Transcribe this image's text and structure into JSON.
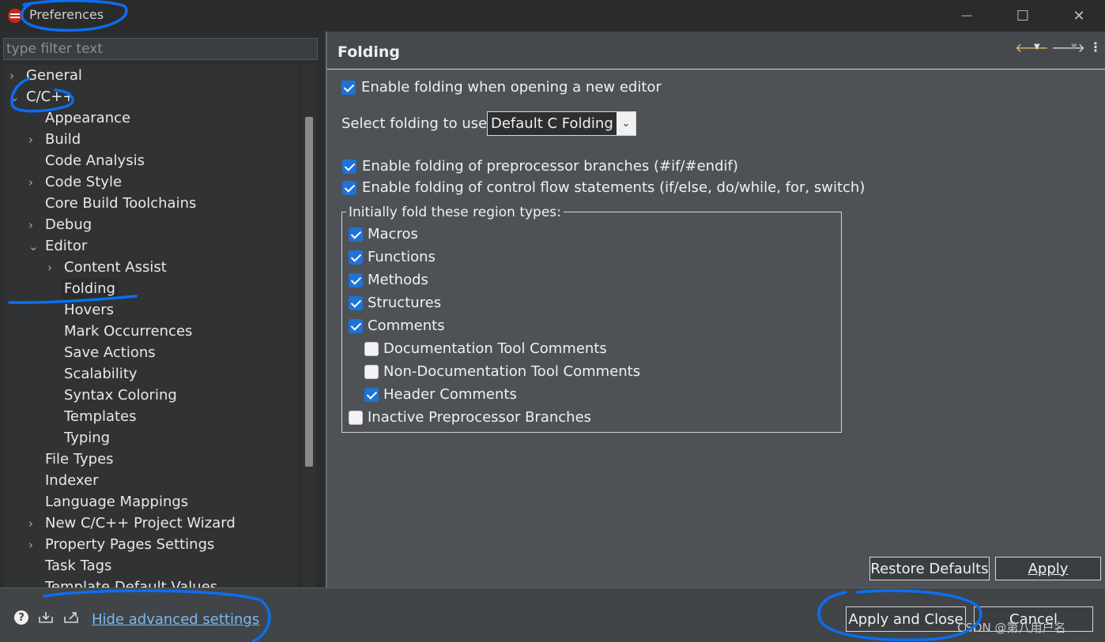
{
  "window": {
    "title": "Preferences",
    "controls": {
      "minimize": "—",
      "maximize": "☐",
      "close": "✕"
    }
  },
  "sidebar": {
    "filter_placeholder": "type filter text",
    "items": [
      {
        "label": "General",
        "level": 0,
        "chevron": "›"
      },
      {
        "label": "C/C++",
        "level": 0,
        "chevron": "⌄"
      },
      {
        "label": "Appearance",
        "level": 1,
        "chevron": ""
      },
      {
        "label": "Build",
        "level": 1,
        "chevron": "›"
      },
      {
        "label": "Code Analysis",
        "level": 1,
        "chevron": ""
      },
      {
        "label": "Code Style",
        "level": 1,
        "chevron": "›"
      },
      {
        "label": "Core Build Toolchains",
        "level": 1,
        "chevron": ""
      },
      {
        "label": "Debug",
        "level": 1,
        "chevron": "›"
      },
      {
        "label": "Editor",
        "level": 1,
        "chevron": "⌄"
      },
      {
        "label": "Content Assist",
        "level": 2,
        "chevron": "›"
      },
      {
        "label": "Folding",
        "level": 2,
        "chevron": "",
        "selected": true
      },
      {
        "label": "Hovers",
        "level": 2,
        "chevron": ""
      },
      {
        "label": "Mark Occurrences",
        "level": 2,
        "chevron": ""
      },
      {
        "label": "Save Actions",
        "level": 2,
        "chevron": ""
      },
      {
        "label": "Scalability",
        "level": 2,
        "chevron": ""
      },
      {
        "label": "Syntax Coloring",
        "level": 2,
        "chevron": ""
      },
      {
        "label": "Templates",
        "level": 2,
        "chevron": ""
      },
      {
        "label": "Typing",
        "level": 2,
        "chevron": ""
      },
      {
        "label": "File Types",
        "level": 1,
        "chevron": ""
      },
      {
        "label": "Indexer",
        "level": 1,
        "chevron": ""
      },
      {
        "label": "Language Mappings",
        "level": 1,
        "chevron": ""
      },
      {
        "label": "New C/C++ Project Wizard",
        "level": 1,
        "chevron": "›"
      },
      {
        "label": "Property Pages Settings",
        "level": 1,
        "chevron": "›"
      },
      {
        "label": "Task Tags",
        "level": 1,
        "chevron": ""
      },
      {
        "label": "Template Default Values",
        "level": 1,
        "chevron": ""
      }
    ]
  },
  "page": {
    "title": "Folding",
    "enable_on_open": {
      "label": "Enable folding when opening a new editor",
      "checked": true
    },
    "select_label": "Select folding to use:",
    "select_value": "Default C Folding",
    "preprocessor": {
      "label": "Enable folding of preprocessor branches (#if/#endif)",
      "checked": true
    },
    "control_flow": {
      "label": "Enable folding of control flow statements (if/else, do/while, for, switch)",
      "checked": true
    },
    "group_title": "Initially fold these region types:",
    "region_types": [
      {
        "label": "Macros",
        "checked": true,
        "indent": 0
      },
      {
        "label": "Functions",
        "checked": true,
        "indent": 0
      },
      {
        "label": "Methods",
        "checked": true,
        "indent": 0
      },
      {
        "label": "Structures",
        "checked": true,
        "indent": 0
      },
      {
        "label": "Comments",
        "checked": true,
        "indent": 0
      },
      {
        "label": "Documentation Tool Comments",
        "checked": false,
        "indent": 1
      },
      {
        "label": "Non-Documentation Tool Comments",
        "checked": false,
        "indent": 1
      },
      {
        "label": "Header Comments",
        "checked": true,
        "indent": 1
      },
      {
        "label": "Inactive Preprocessor Branches",
        "checked": false,
        "indent": 0
      }
    ],
    "restore_defaults": "Restore Defaults",
    "apply": "Apply"
  },
  "footer": {
    "advanced_link": "Hide advanced settings",
    "apply_close": "Apply and Close",
    "cancel": "Cancel",
    "watermark": "CSDN @第八用户名"
  },
  "icons": {
    "help": "help-icon",
    "import": "import-icon",
    "export": "export-icon",
    "back": "back-arrow-icon",
    "forward": "forward-arrow-icon",
    "menu": "view-menu-icon"
  },
  "colors": {
    "accent": "#1f72d6",
    "link": "#7ab8f0",
    "annotation": "#0a6ff0"
  }
}
